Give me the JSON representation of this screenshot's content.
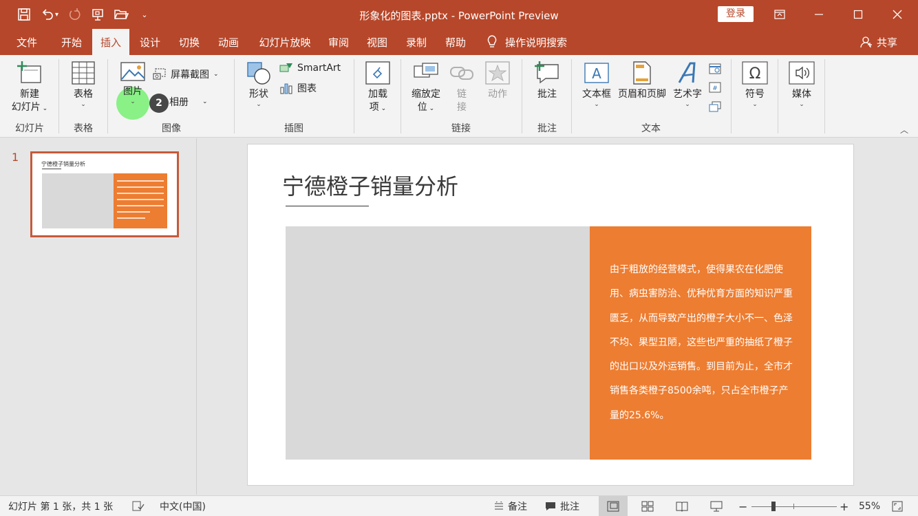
{
  "window": {
    "title": "形象化的图表.pptx  -  PowerPoint Preview",
    "login_label": "登录"
  },
  "menu_tabs": [
    "文件",
    "开始",
    "插入",
    "设计",
    "切换",
    "动画",
    "幻灯片放映",
    "审阅",
    "视图",
    "录制",
    "帮助"
  ],
  "active_tab": "插入",
  "tell_me": "操作说明搜索",
  "share": "共享",
  "ribbon": {
    "new_slide": "新建幻灯片",
    "new_slide_line1": "新建",
    "new_slide_line2": "幻灯片",
    "table": "表格",
    "picture": "图片",
    "screenshot": "屏幕截图",
    "album": "相册",
    "shapes": "形状",
    "smartart": "SmartArt",
    "chart": "图表",
    "addins_line1": "加载",
    "addins_line2": "项",
    "zoom_line1": "缩放定",
    "zoom_line2": "位",
    "link_line1": "链",
    "link_line2": "接",
    "action": "动作",
    "comment": "批注",
    "textbox": "文本框",
    "header_footer": "页眉和页脚",
    "wordart": "艺术字",
    "symbols": "符号",
    "media": "媒体",
    "groups": {
      "slides": "幻灯片",
      "tables": "表格",
      "images": "图像",
      "illustrations": "插图",
      "links": "链接",
      "comments": "批注",
      "text": "文本"
    }
  },
  "step_badge": "2",
  "thumbnail": {
    "number": "1",
    "title": "宁德橙子销量分析"
  },
  "slide": {
    "title": "宁德橙子销量分析",
    "body": "由于粗放的经营模式，使得果农在化肥使用、病虫害防治、优种优育方面的知识严重匮乏，从而导致产出的橙子大小不一、色泽不均、果型丑陋，这些也严重的抽纸了橙子的出口以及外运销售。到目前为止，全市才销售各类橙子8500余吨，只占全市橙子产量的25.6%。"
  },
  "statusbar": {
    "slide_info": "幻灯片 第 1 张，共 1 张",
    "language": "中文(中国)",
    "notes": "备注",
    "comments": "批注",
    "zoom": "55%"
  },
  "colors": {
    "brand": "#b7472a",
    "orange_box": "#ed7d31",
    "gray_box": "#d9d9d9",
    "highlight": "#7df17a"
  }
}
